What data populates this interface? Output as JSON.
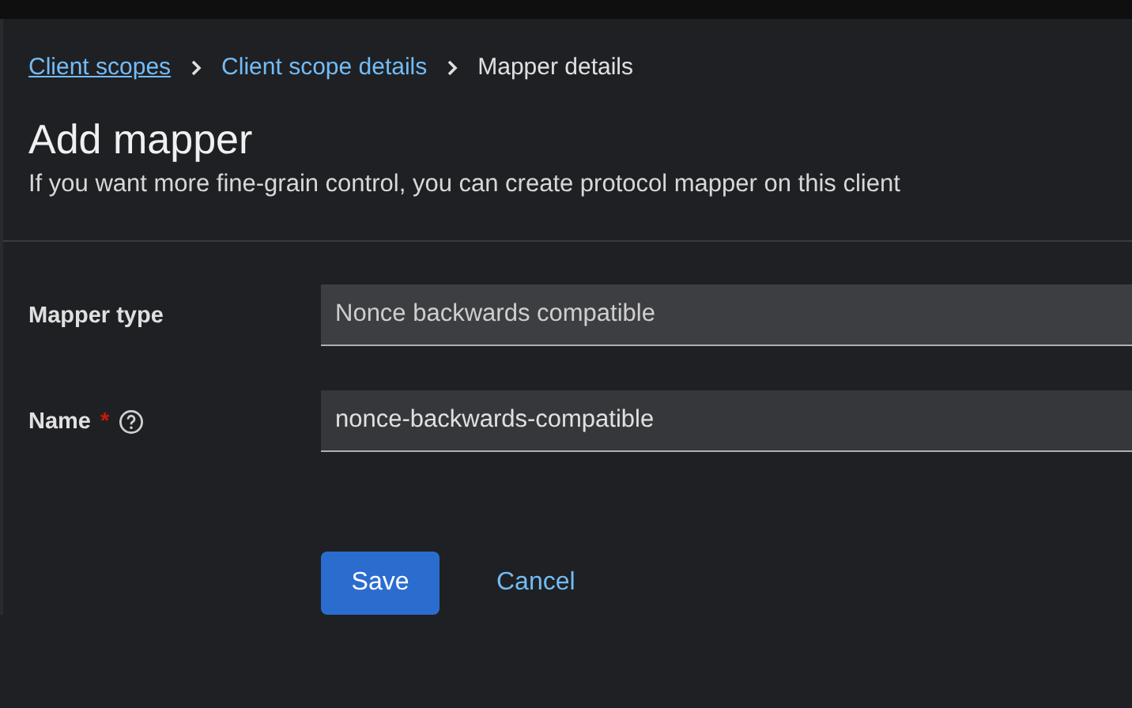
{
  "breadcrumb": [
    {
      "label": "Client scopes",
      "kind": "link",
      "underlined": true
    },
    {
      "label": "Client scope details",
      "kind": "link",
      "underlined": false
    },
    {
      "label": "Mapper details",
      "kind": "current",
      "underlined": false
    }
  ],
  "title": "Add mapper",
  "description": "If you want more fine-grain control, you can create protocol mapper on this client",
  "fields": [
    {
      "label": "Mapper type",
      "value": "Nonce backwards compatible",
      "help": false,
      "readonly": true
    },
    {
      "label": "Name",
      "value": "nonce-backwards-compatible",
      "required_mark": "*",
      "help": true,
      "readonly": false
    }
  ],
  "buttons": [
    {
      "label": "Save",
      "kind": "primary"
    },
    {
      "label": "Cancel",
      "kind": "link"
    }
  ]
}
